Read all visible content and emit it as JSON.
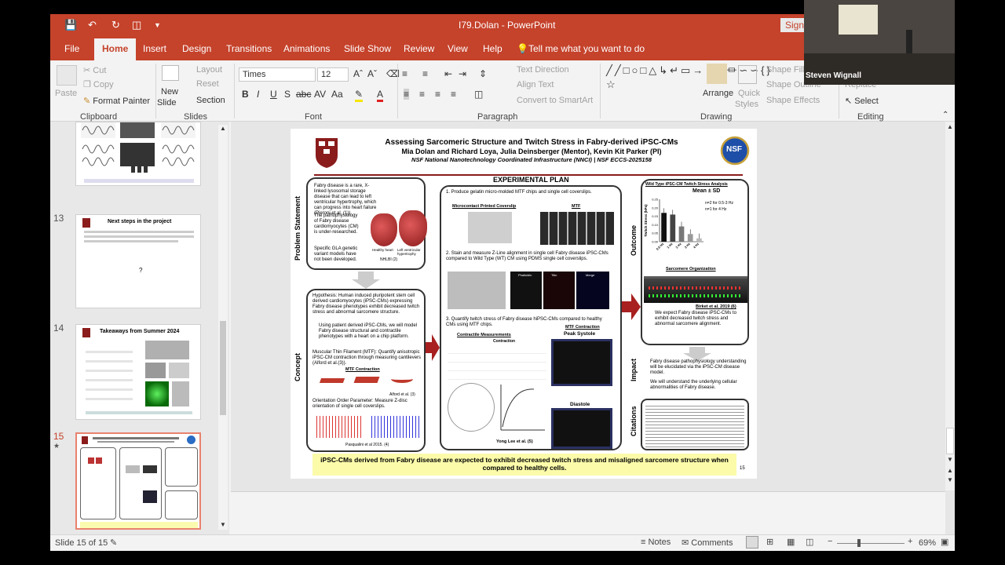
{
  "titlebar": {
    "title": "I79.Dolan - PowerPoint",
    "sign_in": "Sign"
  },
  "menu": [
    "File",
    "Home",
    "Insert",
    "Design",
    "Transitions",
    "Animations",
    "Slide Show",
    "Review",
    "View",
    "Help"
  ],
  "tell_me": "Tell me what you want to do",
  "ribbon": {
    "clipboard": {
      "paste": "Paste",
      "cut": "Cut",
      "copy": "Copy",
      "format_painter": "Format Painter",
      "label": "Clipboard"
    },
    "slides": {
      "new_slide_1": "New",
      "new_slide_2": "Slide",
      "layout": "Layout",
      "reset": "Reset",
      "section": "Section",
      "label": "Slides"
    },
    "font": {
      "name": "Times",
      "size": "12",
      "label": "Font"
    },
    "paragraph": {
      "text_direction": "Text Direction",
      "align_text": "Align Text",
      "convert": "Convert to SmartArt",
      "label": "Paragraph"
    },
    "drawing": {
      "arrange": "Arrange",
      "quick_styles_1": "Quick",
      "quick_styles_2": "Styles",
      "shape_fill": "Shape Fill",
      "shape_outline": "Shape Outline",
      "shape_effects": "Shape Effects",
      "label": "Drawing"
    },
    "editing": {
      "replace": "Replace",
      "select": "Select",
      "label": "Editing"
    }
  },
  "thumbnails": [
    {
      "num": "13",
      "title": "Next steps in the project"
    },
    {
      "num": "14",
      "title": "Takeaways from Summer 2024"
    },
    {
      "num": "15"
    }
  ],
  "slide": {
    "title": "Assessing Sarcomeric Structure and Twitch Stress in Fabry-derived iPSC-CMs",
    "authors": "Mia Dolan and Richard Loya, Julia Deinsberger (Mentor), Kevin Kit Parker (PI)",
    "affiliation": "NSF National Nanotechnology Coordinated Infrastructure (NNCI) | NSF ECCS-2025158",
    "nsf": "NSF",
    "problem_label": "Problem Statement",
    "problem_bullets": [
      "Fabry disease is a rare, X-linked lysosomal storage disease that can lead to left ventricular hypertrophy, which can progress into heart failure (Pieroni et al. (1)).",
      "The pathophysiology of Fabry disease cardiomyocytes (CM) is under-researched.",
      "Specific GLA genetic variant models have not been developed."
    ],
    "heart_caption_1": "Healthy heart",
    "heart_caption_2": "Left ventricular hypertrophy",
    "heart_caption_3": "NHLBI (2)",
    "concept_label": "Concept",
    "hypothesis": "Hypothesis: Human induced pluripotent stem cell derived cardiomyocytes (iPSC-CMs) expressing Fabry disease phenotypes exhibit decreased twitch stress and abnormal sarcomere structure.",
    "concept_bullet": "Using patient derived iPSC-CMs, we will model Fabry disease structural and contractile phenotypes with a heart on a chip platform.",
    "mtf_text": "Muscular Thin Filament (MTF): Quantify anisotropic iPSC-CM contraction through measuring cantilevers (Alford et al.(3)).",
    "mtf_contraction": "MTF Contraction",
    "alford": "Alford et al. (3)",
    "oop_text": "Orientation Order Parameter: Measure Z-disc orientation of single cell coverslips.",
    "pasqualini": "Pasqualini et al 2015. (4)",
    "exp_plan": "EXPERIMENTAL PLAN",
    "step1": "1. Produce gelatin micro-molded MTF chips and single cell coverslips.",
    "microcontact": "Microcontact Printed Coverslip",
    "mtf": "MTF",
    "step2": "2. Stain and measure Z-Line alignment in single cell Fabry disease iPSC-CMs compared to Wild Type (WT) CM using PDMS single cell coverslips.",
    "stain_labels": [
      "Phalloidin",
      "DAPI",
      "Titin",
      "Merge"
    ],
    "step3": "3. Quantify twitch stress of Fabry disease hiPSC-CMs compared to healthy CMs using MTF chips.",
    "contractile": "Contractile Measurements",
    "contraction": "Contraction",
    "mtf_contraction2": "MTF Contraction",
    "peak_systole": "Peak Systole",
    "diastole": "Diastole",
    "yong_lee": "Yong Lee et al. (5)",
    "outcome_label": "Outcome",
    "chart_title": "Wild Type iPSC-CM Twitch Stress Analysis",
    "mean_sd": "Mean ± SD",
    "n_note_1": "n=2 for 0.5-3 Hz",
    "n_note_2": "n=1 for 4 Hz",
    "sarcomere_org": "Sarcomere Organization",
    "birket": "Birket et al. 2019 (6)",
    "outcome_bullet": "We expect Fabry disease iPSC-CMs to exhibit decreased twitch stress and abnormal sarcomere alignment.",
    "impact_label": "Impact",
    "impact_bullets": [
      "Fabry disease pathophysiology understanding will be elucidated via the iPSC-CM disease model.",
      "We will understand the underlying cellular abnormalities of Fabry disease."
    ],
    "citations_label": "Citations",
    "conclusion": "iPSC-CMs derived from Fabry disease are expected to exhibit decreased twitch stress and misaligned sarcomere structure when compared to healthy cells.",
    "page_num": "15"
  },
  "chart_data": {
    "type": "bar",
    "title": "Wild Type iPSC-CM Twitch Stress Analysis",
    "ylabel": "Twitch Stress (kPa)",
    "categories": [
      "0.5 Hz",
      "1 Hz",
      "2 Hz",
      "3 Hz",
      "4 Hz"
    ],
    "values": [
      0.17,
      0.16,
      0.09,
      0.045,
      0.02
    ],
    "ylim": [
      0,
      0.25
    ],
    "yticks": [
      "0.00",
      "0.05",
      "0.10",
      "0.15",
      "0.20",
      "0.25"
    ],
    "colors": [
      "#111111",
      "#444444",
      "#777777",
      "#999999",
      "#bbbbbb"
    ]
  },
  "status": {
    "slide_of": "Slide 15 of 15",
    "notes": "Notes",
    "comments": "Comments",
    "zoom": "69%"
  },
  "webcam": {
    "name": "Steven Wignall"
  }
}
